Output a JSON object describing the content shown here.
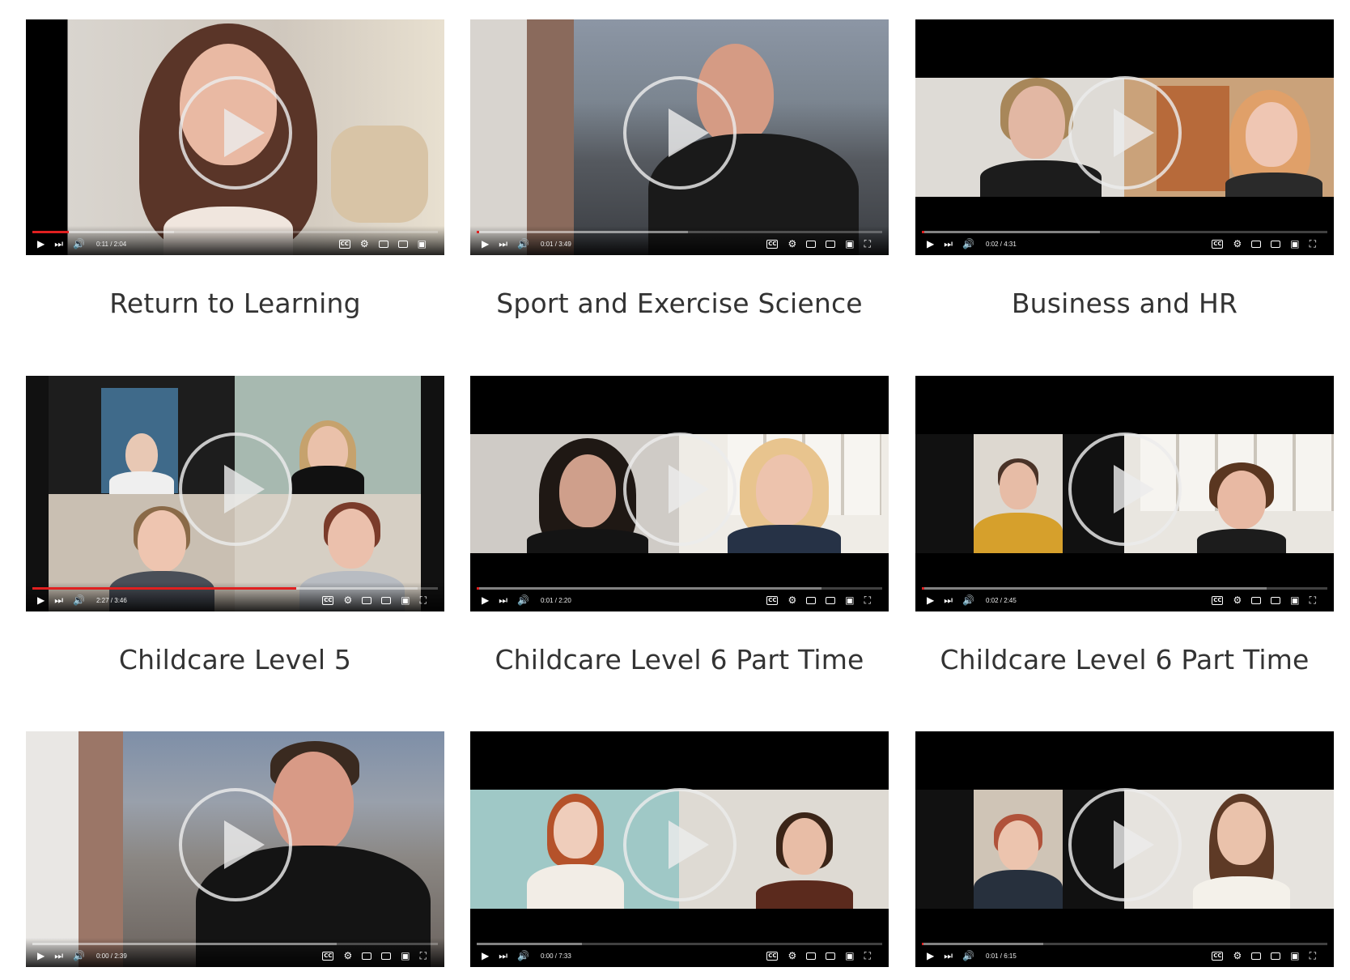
{
  "videos": [
    {
      "title": "Return to Learning",
      "time": "0:11 / 2:04",
      "progress": 0.09
    },
    {
      "title": "Sport and Exercise Science",
      "time": "0:01 / 3:49",
      "progress": 0.0
    },
    {
      "title": "Business and HR",
      "time": "0:02 / 4:31",
      "progress": 0.0
    },
    {
      "title": "Childcare Level 5",
      "time": "2:27 / 3:46",
      "progress": 0.65
    },
    {
      "title": "Childcare Level 6 Part Time",
      "time": "0:01 / 2:20",
      "progress": 0.0
    },
    {
      "title": "Childcare Level 6 Part Time",
      "time": "0:02 / 2:45",
      "progress": 0.0
    },
    {
      "title": "",
      "time": "0:00 / 2:39",
      "progress": 0.0
    },
    {
      "title": "",
      "time": "0:00 / 7:33",
      "progress": 0.0
    },
    {
      "title": "",
      "time": "0:01 / 6:15",
      "progress": 0.0
    }
  ],
  "icons": {
    "play": "play-icon",
    "next": "next-icon",
    "volume": "volume-icon",
    "captions": "captions-icon",
    "settings": "gear-icon",
    "miniplayer": "miniplayer-icon",
    "theater": "theater-icon",
    "cast": "cast-icon",
    "fullscreen": "fullscreen-icon",
    "big_play": "play-circle-icon"
  },
  "colors": {
    "progress_played": "#e02020",
    "title_text": "#333333",
    "player_bg": "#000000"
  },
  "controls": {
    "cc_label": "CC"
  }
}
